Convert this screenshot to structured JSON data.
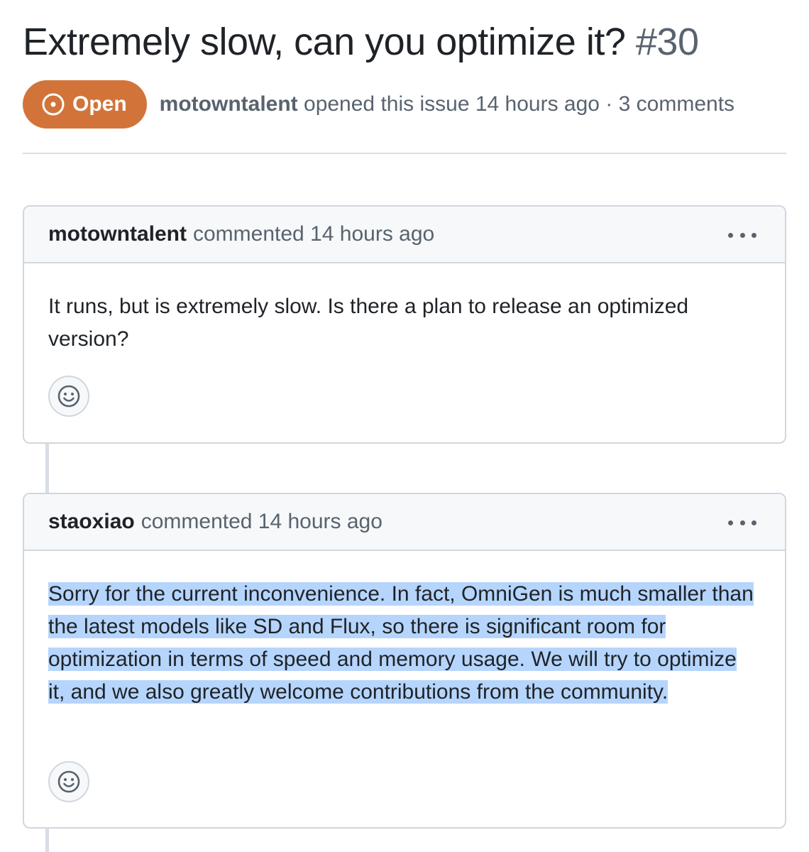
{
  "issue": {
    "title": "Extremely slow, can you optimize it?",
    "number": "#30",
    "state": "Open",
    "author": "motowntalent",
    "meta": " opened this issue 14 hours ago · 3 comments"
  },
  "comments": [
    {
      "author": "motowntalent",
      "meta": "commented 14 hours ago",
      "body": "It runs, but is extremely slow. Is there a plan to release an optimized version?"
    },
    {
      "author": "staoxiao",
      "meta": "commented 14 hours ago",
      "body": "Sorry for the current inconvenience. In fact, OmniGen is much smaller than the latest models like SD and Flux, so there is significant room for optimization in terms of speed and memory usage. We will try to optimize it, and we also greatly welcome contributions from the community."
    }
  ],
  "colors": {
    "open_badge": "#d2743a",
    "selection": "#b6d5fc",
    "muted_text": "#59636e",
    "border": "#d0d7de"
  },
  "icons": {
    "state": "issue-opened-icon",
    "menu": "kebab-horizontal-icon",
    "reaction": "smiley-icon"
  }
}
